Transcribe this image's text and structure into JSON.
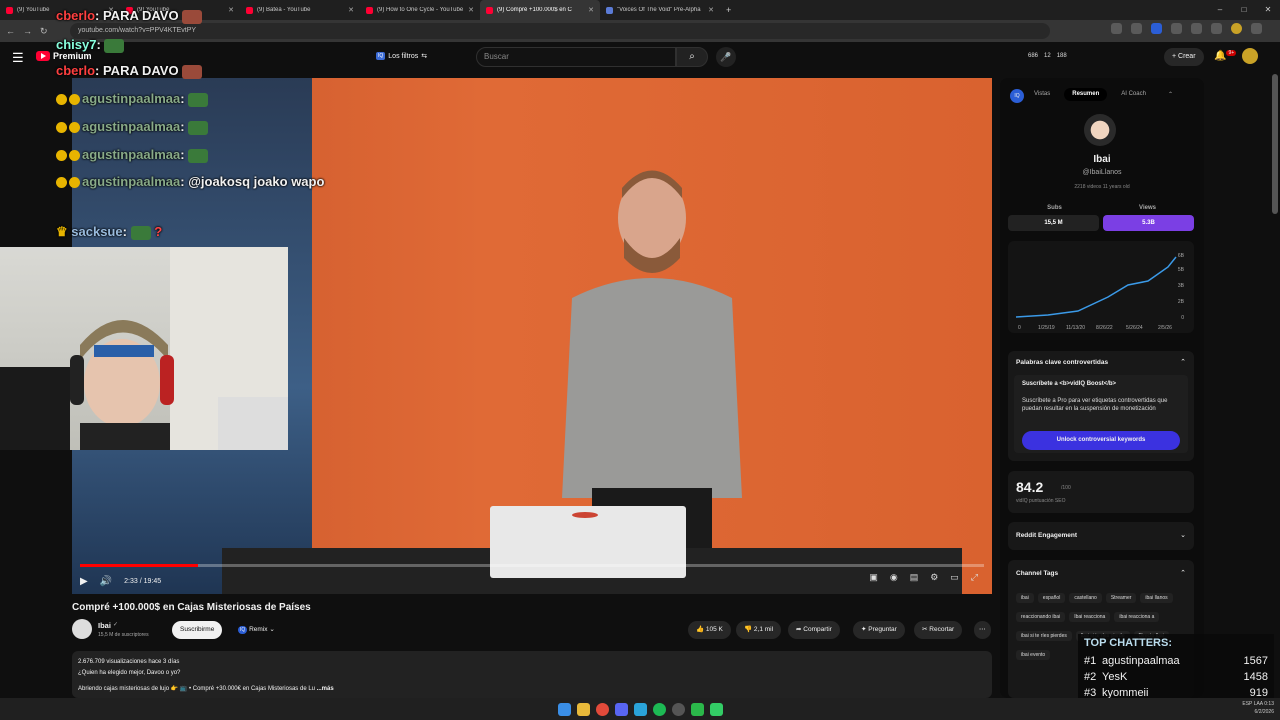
{
  "browser": {
    "tabs": [
      {
        "title": "(9) YouTube",
        "active": false
      },
      {
        "title": "(9) YouTube",
        "active": false
      },
      {
        "title": "(9) Batea - YouTube",
        "active": false
      },
      {
        "title": "(9) How to One Cycle - YouTube",
        "active": false
      },
      {
        "title": "(9) Compré +100.000$ en C",
        "active": true
      },
      {
        "title": "\"Voices Of The Void\" Pre-Alpha",
        "active": false
      }
    ],
    "new_tab": "+",
    "url": "youtube.com/watch?v=PPV4KTEvtPY",
    "window_controls": [
      "–",
      "□",
      "✕"
    ]
  },
  "yt": {
    "menu_icon": "☰",
    "logo_text": "Premium",
    "filters_badge": "IQ",
    "filters_label": "Los filtros",
    "search_placeholder": "Buscar",
    "search_icon": "⌕",
    "mic_icon": "🎤",
    "stats": [
      "686",
      "12",
      "188"
    ],
    "create_label": "+ Crear",
    "bell_badge": "9+"
  },
  "chat": {
    "lines": [
      {
        "user": "cberlo",
        "sep": ":",
        "text": " PARA DAVO"
      },
      {
        "user": "chisy7",
        "sep": ":",
        "text": ""
      },
      {
        "user": "cberlo",
        "sep": ":",
        "text": " PARA DAVO"
      },
      {
        "user": "agustinpaalmaa",
        "sep": ":",
        "text": ""
      },
      {
        "user": "agustinpaalmaa",
        "sep": ":",
        "text": ""
      },
      {
        "user": "agustinpaalmaa",
        "sep": ":",
        "text": ""
      },
      {
        "user": "agustinpaalmaa",
        "sep": ":",
        "text": " @joakosq joako wapo"
      },
      {
        "user": "sacksue",
        "sep": ":",
        "text": " ?"
      }
    ]
  },
  "player": {
    "time": "2:33 / 19:45",
    "progress": 0.13,
    "play_icon": "▶",
    "volume_icon": "🔊"
  },
  "video": {
    "title": "Compré +100.000$ en Cajas Misteriosas de Países",
    "channel": "Ibai",
    "verified": "✓",
    "subscribers": "15,5 M de suscriptores",
    "subscribe_label": "Suscribirme",
    "remix_badge": "IQ",
    "remix_label": "Remix",
    "likes": "105 K",
    "dislikes": "2,1 mil",
    "share_label": "Compartir",
    "ask_label": "Preguntar",
    "clip_label": "Recortar",
    "more": "⋯",
    "views_line": "2.676.709 visualizaciones  hace 3 días",
    "desc_line1": "¿Quien ha elegido mejor, Davoo o yo?",
    "desc_line2": "Abriendo cajas misteriosas de lujo 👉 📺 • Compré +30.000€ en Cajas Misteriosas de Lu",
    "desc_more": "...más"
  },
  "vidiq": {
    "logo": "IQ",
    "tabs": [
      "Vistas",
      "Resumen",
      "AI Coach"
    ],
    "active_tab": "Resumen",
    "channel_name": "Ibai",
    "handle": "@IbaiLlanos",
    "meta": "2218 videos    11 years old",
    "subs_label": "Subs",
    "views_label": "Views",
    "subs_value": "15,5 M",
    "views_value": "5.3B",
    "chart_y_ticks": [
      "6B",
      "5B",
      "3B",
      "2B",
      "0"
    ],
    "chart_x_ticks": [
      "0",
      "1/25/19",
      "11/13/20",
      "8/26/22",
      "5/26/24",
      "2/5/26"
    ],
    "contro_title": "Palabras clave controvertidas",
    "contro_sub": "Suscríbete a <b>vidIQ Boost</b>",
    "contro_body": "Suscríbete a Pro para ver etiquetas controvertidas que puedan resultar en la suspensión de monetización",
    "unlock_label": "Unlock controversial keywords",
    "seo_score": "84.2",
    "seo_denominator": "/100",
    "seo_label": "vidIQ puntuación SEO",
    "reddit_label": "Reddit Engagement",
    "tags_title": "Channel Tags",
    "tags": [
      "ibai",
      "español",
      "castellano",
      "Streamer",
      "ibai llanos",
      "reaccionando ibai",
      "Ibai reacciona",
      "ibai reacciona a",
      "ibai si te ríes pierdes",
      "Ibai si te ríes pierde",
      "Directo Ibai",
      "ibai evento"
    ]
  },
  "top_chatters": {
    "title": "TOP CHATTERS:",
    "rows": [
      {
        "rank": "#1",
        "name": "agustinpaalmaa",
        "count": "1567"
      },
      {
        "rank": "#2",
        "name": "YesK",
        "count": "1458"
      },
      {
        "rank": "#3",
        "name": "kyommeii",
        "count": "919"
      }
    ]
  },
  "tray": {
    "lang": "ESP LAA",
    "time": "0:13",
    "date": "6/2/2026"
  },
  "colors": {
    "accent_red": "#ff0033",
    "vidiq_purple": "#7b3fe4",
    "vidiq_blue": "#2b5ed6",
    "unlock_button": "#3b32e0"
  }
}
